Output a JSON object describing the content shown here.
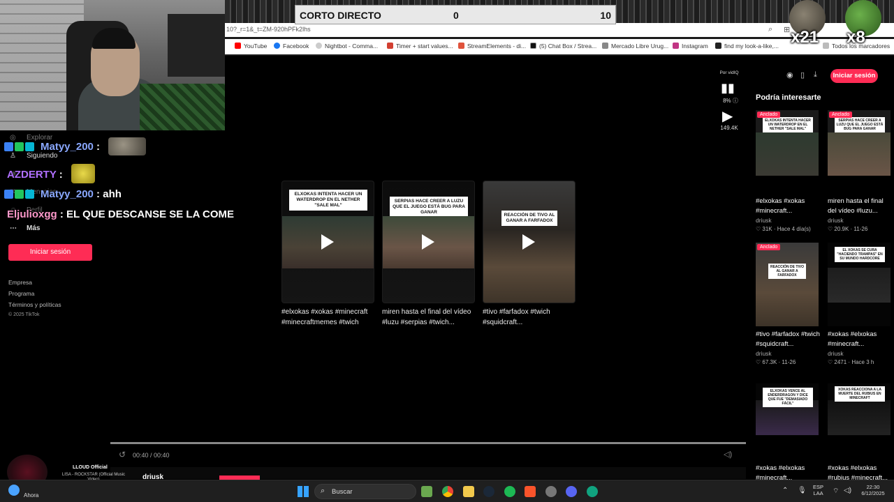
{
  "browser": {
    "address": "10?_r=1&_t=ZM-920hPFk2lhs",
    "bookmarks": [
      {
        "label": "YouTube",
        "color": "#ff0000"
      },
      {
        "label": "Facebook",
        "color": "#1877f2"
      },
      {
        "label": "Nightbot - Comma...",
        "color": "#cccccc"
      },
      {
        "label": "Timer + start values...",
        "color": "#d23f31"
      },
      {
        "label": "StreamElements - di...",
        "color": "#e0533c"
      },
      {
        "label": "(5) Chat Box / Strea...",
        "color": "#111111"
      },
      {
        "label": "Mercado Libre Urug...",
        "color": "#888888"
      },
      {
        "label": "Instagram",
        "color": "#c13584"
      },
      {
        "label": "find my look-a-like,...",
        "color": "#222222"
      }
    ],
    "all_bookmarks": "Todos los marcadores"
  },
  "overlay": {
    "title": "CORTO DIRECTO",
    "score_left": "0",
    "score_right": "10",
    "emote_counts": [
      "x21",
      "x8"
    ]
  },
  "sidebar": {
    "nav": [
      "Explorar",
      "Siguiendo",
      "LIVE",
      "Mensajes",
      "Perfil",
      "Más"
    ],
    "login": "Iniciar sesión",
    "footer": [
      "Empresa",
      "Programa",
      "Términos y políticas"
    ],
    "copyright": "© 2025 TikTok"
  },
  "chat": [
    {
      "user": "Matyy_200",
      "user_color": "#8aa8ff",
      "text": " : ",
      "emote": "monkey"
    },
    {
      "user": "AZDERTY",
      "user_color": "#b070ff",
      "text": " : ",
      "emote": "sponge"
    },
    {
      "user": "Matyy_200",
      "user_color": "#8aa8ff",
      "text": " : ahh",
      "emote": ""
    },
    {
      "user": "Eljulioxgg",
      "user_color": "#ff99cc",
      "text": " : EL QUE DESCANSE SE LA COME",
      "emote": ""
    }
  ],
  "feed": [
    {
      "banner": "ELXOKAS INTENTA HACER UN WATERDROP EN EL NETHER \"SALE MAL\"",
      "caption": "#elxokas #xokas #minecraft #minecraftmemes #twich"
    },
    {
      "banner": "SERPIAS HACE CREER A LUZU QUE EL JUEGO ESTÁ BUG PARA GANAR",
      "caption": "miren hasta el final del vídeo #luzu #serpias #twich..."
    },
    {
      "banner": "REACCIÓN DE TIVO AL GANAR A FARFADOX",
      "caption": "#tivo #farfadox #twich #squidcraft..."
    }
  ],
  "actions": {
    "by": "Por vidIQ",
    "percent": "8%",
    "views": "149.4K"
  },
  "right_panel": {
    "title": "Podría interesarte",
    "login": "Iniciar sesión",
    "items": [
      {
        "tag": "Anclado",
        "banner": "ELXOKAS INTENTA HACER UN WATERDROP EN EL NETHER \"SALE MAL\"",
        "title": "#elxokas #xokas #minecraft...",
        "author": "driusk",
        "likes": "31K",
        "when": "Hace 4 día(s)"
      },
      {
        "tag": "Anclado",
        "banner": "SERPIAS HACE CREER A LUZU QUE EL JUEGO ESTÁ BUG PARA GANAR",
        "title": "miren hasta el final del vídeo #luzu...",
        "author": "driusk",
        "likes": "20.9K",
        "when": "11-26"
      },
      {
        "tag": "Anclado",
        "banner": "REACCIÓN DE TIVO AL GANAR A FARFADOX",
        "title": "#tivo #farfadox #twich #squidcraft...",
        "author": "driusk",
        "likes": "67.3K",
        "when": "11-26"
      },
      {
        "tag": "",
        "banner": "EL XOKAS SE CURA \"HACIENDO TRAMPAS\" EN SU MUNDO HARDCORE",
        "title": "#xokas #elxokas #minecraft...",
        "author": "driusk",
        "likes": "2471",
        "when": "Hace 3 h"
      },
      {
        "tag": "",
        "banner": "ELXOKAS VENCE AL ENDERDRAGON Y DICE QUE FUE \"DEMASIADO FÁCIL\"",
        "title": "#xokas #elxokas #minecraft...",
        "author": "",
        "likes": "",
        "when": ""
      },
      {
        "tag": "",
        "banner": "XOKAS REACCIONA A LA MUERTE DEL RUBIUS EN MINECRAFT",
        "title": "#xokas #elxokas #rubius #minecraft...",
        "author": "",
        "likes": "",
        "when": ""
      }
    ]
  },
  "player": {
    "time": "00:40 / 00:40",
    "author": "driusk",
    "progress_fraction": 1.0
  },
  "music": {
    "artist": "LLOUD Official",
    "song": "LISA - ROCKSTAR (Official Music Video)"
  },
  "taskbar": {
    "weather": "Ahora",
    "search": "Buscar",
    "lang_top": "ESP",
    "lang_bottom": "LAA",
    "clock_time": "22:30",
    "clock_date": "6/12/2025"
  }
}
